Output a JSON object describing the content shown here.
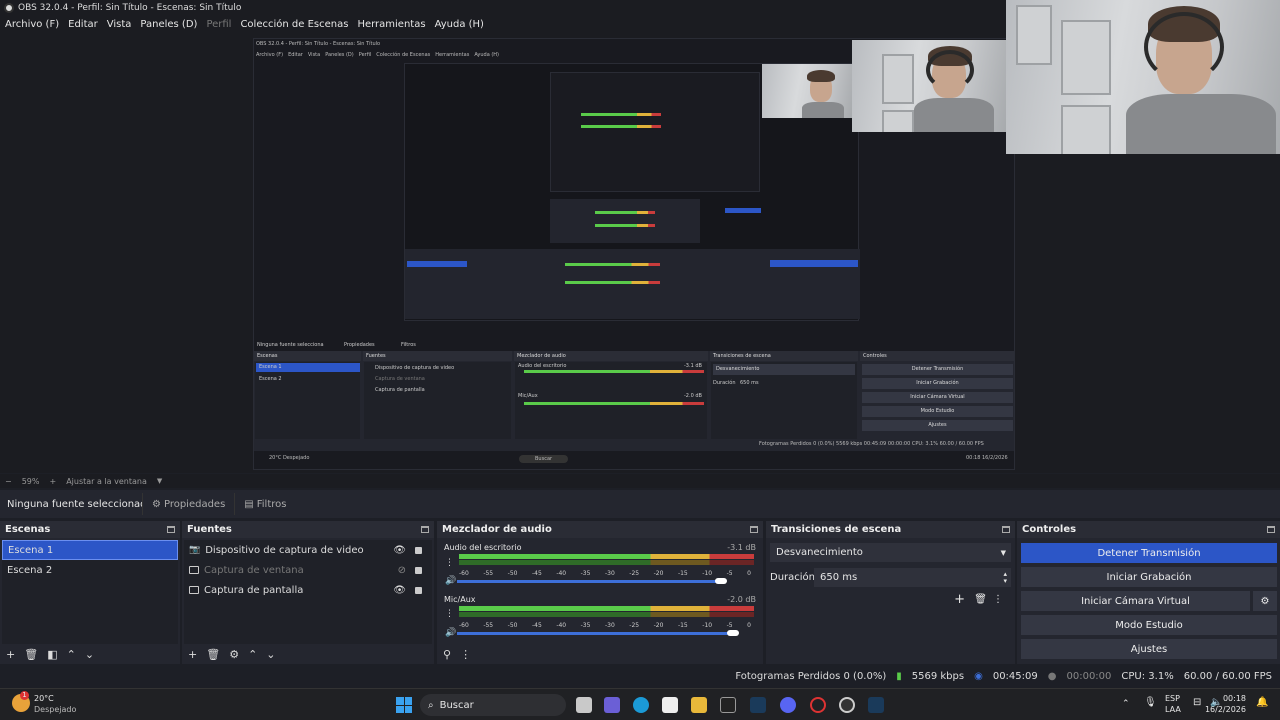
{
  "window": {
    "title": "OBS 32.0.4 - Perfil: Sin Título - Escenas: Sin Título"
  },
  "menu": {
    "items": [
      "Archivo (F)",
      "Editar",
      "Vista",
      "Paneles (D)",
      "Perfil",
      "Colección de Escenas",
      "Herramientas",
      "Ayuda (H)"
    ]
  },
  "zoom": {
    "minus": "−",
    "value": "59%",
    "plus": "+",
    "fit": "Ajustar a la ventana"
  },
  "props": {
    "no_source": "Ninguna fuente seleccionada",
    "properties": "Propiedades",
    "filters": "Filtros"
  },
  "scenes": {
    "title": "Escenas",
    "items": [
      "Escena 1",
      "Escena 2"
    ]
  },
  "sources": {
    "title": "Fuentes",
    "items": [
      {
        "label": "Dispositivo de captura de video",
        "visible": true,
        "icon": "camera-icon"
      },
      {
        "label": "Captura de ventana",
        "visible": false,
        "icon": "window-icon"
      },
      {
        "label": "Captura de pantalla",
        "visible": true,
        "icon": "monitor-icon"
      }
    ]
  },
  "mixer": {
    "title": "Mezclador de audio",
    "channels": [
      {
        "name": "Audio del escritorio",
        "db": "-3.1 dB",
        "level": 0.9
      },
      {
        "name": "Mic/Aux",
        "db": "-2.0 dB",
        "level": 0.87
      }
    ],
    "scale": [
      "-60",
      "-55",
      "-50",
      "-45",
      "-40",
      "-35",
      "-30",
      "-25",
      "-20",
      "-15",
      "-10",
      "-5",
      "0"
    ]
  },
  "transitions": {
    "title": "Transiciones de escena",
    "selected": "Desvanecimiento",
    "duration_label": "Duración",
    "duration_value": "650 ms"
  },
  "controls": {
    "title": "Controles",
    "buttons": [
      "Detener Transmisión",
      "Iniciar Grabación",
      "Iniciar Cámara Virtual",
      "Modo Estudio",
      "Ajustes"
    ]
  },
  "status": {
    "dropped": "Fotogramas Perdidos 0 (0.0%)",
    "bitrate": "5569 kbps",
    "stream_time": "00:45:09",
    "rec_time": "00:00:00",
    "cpu": "CPU: 3.1%",
    "fps": "60.00 / 60.00 FPS"
  },
  "taskbar": {
    "weather_temp": "20°C",
    "weather_desc": "Despejado",
    "search": "Buscar",
    "lang1": "ESP",
    "lang2": "LAA",
    "time": "00:18",
    "date": "16/2/2026",
    "notif": "1"
  },
  "nested": {
    "title": "OBS 32.0.4 - Perfil: Sin Título - Escenas: Sin Título",
    "menu": [
      "Archivo (F)",
      "Editar",
      "Vista",
      "Paneles (D)",
      "Perfil",
      "Colección de Escenas",
      "Herramientas",
      "Ayuda (H)"
    ],
    "no_source": "Ninguna fuente selecciona",
    "props": "Propiedades",
    "filters": "Filtros",
    "zoom": "59%",
    "fit": "Ajustar a la ventana",
    "scenes_title": "Escenas",
    "scenes": [
      "Escena 1",
      "Escena 2"
    ],
    "sources_title": "Fuentes",
    "sources": [
      "Dispositivo de captura de video",
      "Captura de ventana",
      "Captura de pantalla"
    ],
    "mixer_title": "Mezclador de audio",
    "ch1": "Audio del escritorio",
    "ch1_db": "-3.1 dB",
    "ch2": "Mic/Aux",
    "ch2_db": "-2.0 dB",
    "trans_title": "Transiciones de escena",
    "trans": "Desvanecimiento",
    "dur_label": "Duración",
    "dur": "650 ms",
    "ctrl_title": "Controles",
    "ctrl": [
      "Detener Transmisión",
      "Iniciar Grabación",
      "Iniciar Cámara Virtual",
      "Modo Estudio",
      "Ajustes"
    ],
    "status": "Fotogramas Perdidos 0 (0.0%)   5569 kbps   00:45:09   00:00:00   CPU: 3.1%   60.00 / 60.00 FPS",
    "weather": "20°C Despejado",
    "search": "Buscar",
    "clock": "00:18 16/2/2026"
  },
  "colors": {
    "accent": "#2c56c7",
    "bg": "#1d1f26",
    "dock": "#24262f",
    "meter_green": "#5acb4a",
    "meter_yellow": "#e0b23a",
    "meter_red": "#c93c3c"
  }
}
